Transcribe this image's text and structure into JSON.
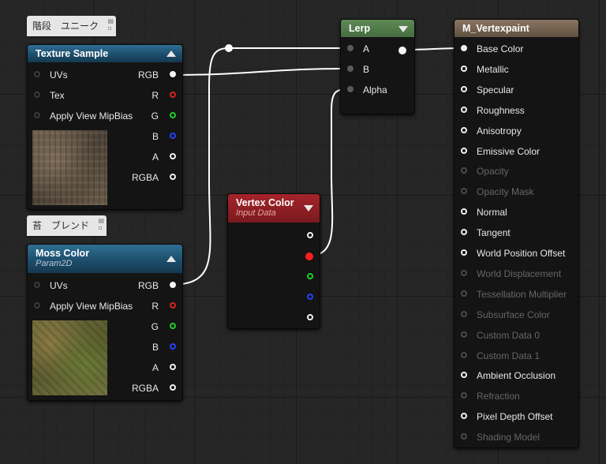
{
  "comments": {
    "texture_comment": "階段　ユニーク",
    "moss_comment": "苔　ブレンド"
  },
  "texture_sample": {
    "title": "Texture Sample",
    "inputs": [
      "UVs",
      "Tex",
      "Apply View MipBias"
    ],
    "outputs": [
      "RGB",
      "R",
      "G",
      "B",
      "A",
      "RGBA"
    ]
  },
  "moss_color": {
    "title": "Moss Color",
    "subtitle": "Param2D",
    "inputs": [
      "UVs",
      "Apply View MipBias"
    ],
    "outputs": [
      "RGB",
      "R",
      "G",
      "B",
      "A",
      "RGBA"
    ]
  },
  "lerp": {
    "title": "Lerp",
    "inputs": [
      "A",
      "B",
      "Alpha"
    ]
  },
  "vertex_color": {
    "title": "Vertex Color",
    "subtitle": "Input Data"
  },
  "material": {
    "title": "M_Vertexpaint",
    "pins": [
      {
        "label": "Base Color",
        "enabled": true
      },
      {
        "label": "Metallic",
        "enabled": true
      },
      {
        "label": "Specular",
        "enabled": true
      },
      {
        "label": "Roughness",
        "enabled": true
      },
      {
        "label": "Anisotropy",
        "enabled": true
      },
      {
        "label": "Emissive Color",
        "enabled": true
      },
      {
        "label": "Opacity",
        "enabled": false
      },
      {
        "label": "Opacity Mask",
        "enabled": false
      },
      {
        "label": "Normal",
        "enabled": true
      },
      {
        "label": "Tangent",
        "enabled": true
      },
      {
        "label": "World Position Offset",
        "enabled": true
      },
      {
        "label": "World Displacement",
        "enabled": false
      },
      {
        "label": "Tessellation Multiplier",
        "enabled": false
      },
      {
        "label": "Subsurface Color",
        "enabled": false
      },
      {
        "label": "Custom Data 0",
        "enabled": false
      },
      {
        "label": "Custom Data 1",
        "enabled": false
      },
      {
        "label": "Ambient Occlusion",
        "enabled": true
      },
      {
        "label": "Refraction",
        "enabled": false
      },
      {
        "label": "Pixel Depth Offset",
        "enabled": true
      },
      {
        "label": "Shading Model",
        "enabled": false
      }
    ]
  },
  "colors": {
    "background": "#262626",
    "wire": "#ffffff",
    "header_texture": "#1d4e6c",
    "header_lerp": "#466c40",
    "header_vertex": "#7a1a1e",
    "header_material": "#5f5040"
  }
}
